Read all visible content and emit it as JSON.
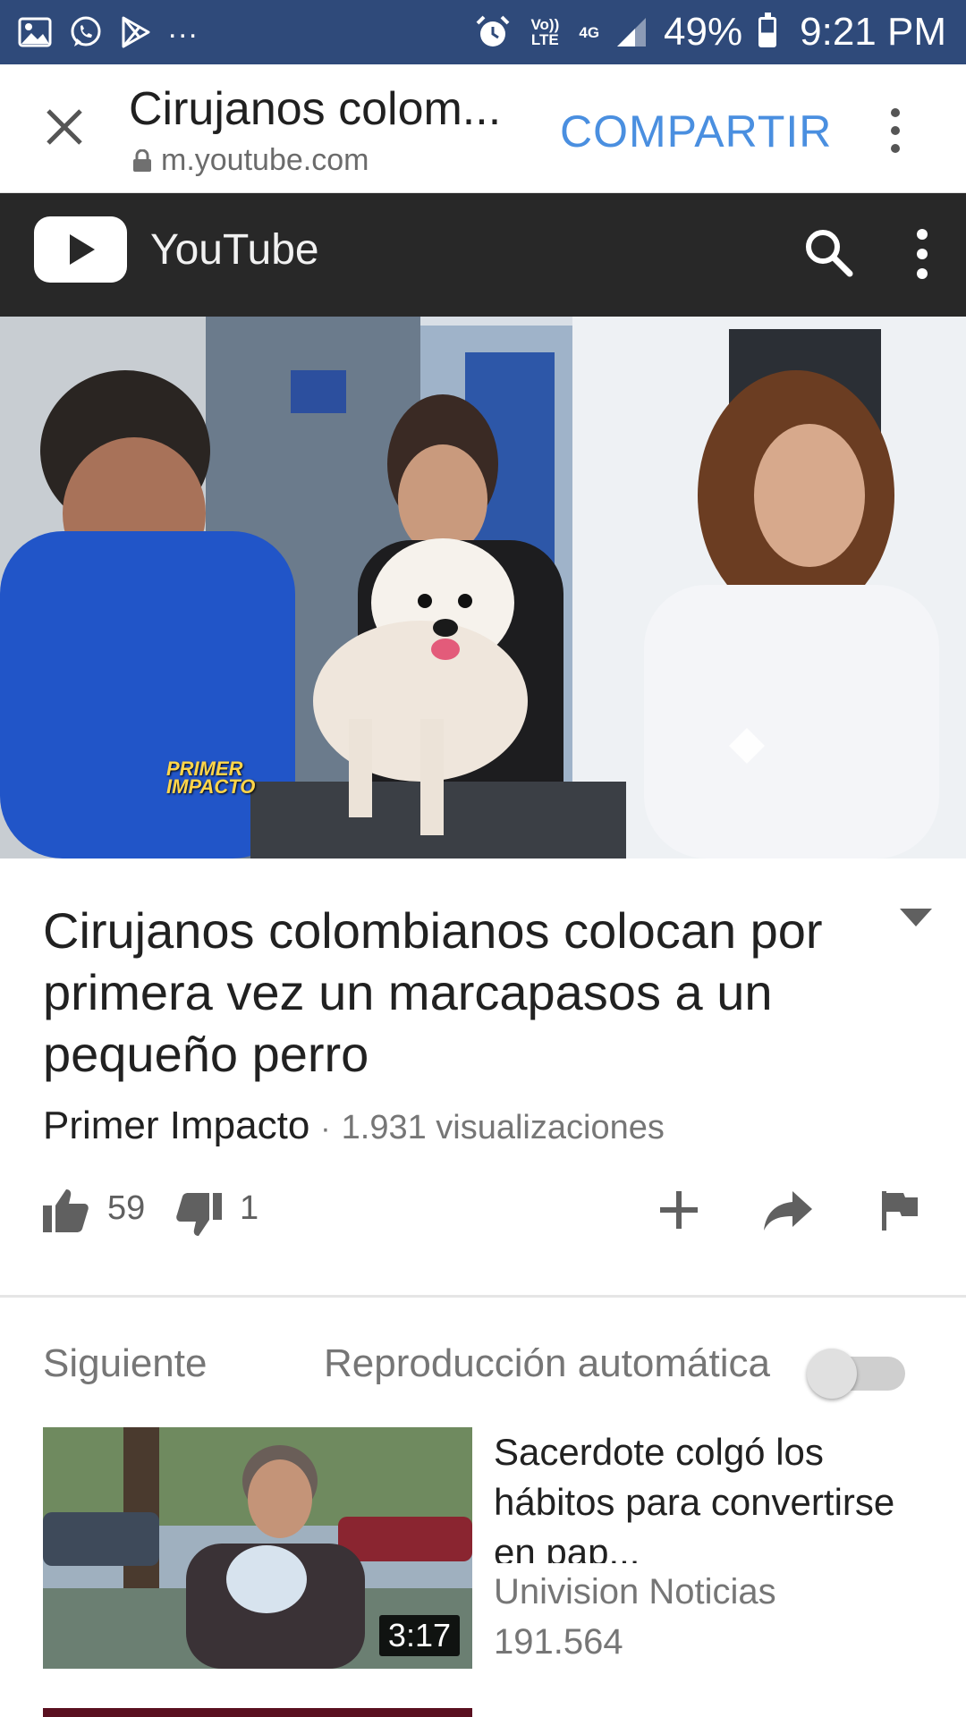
{
  "status_bar": {
    "overflow": "...",
    "volte": "Vo)) LTE",
    "network": "4G",
    "battery": "49%",
    "time": "9:21 PM"
  },
  "tab": {
    "title": "Cirujanos colom...",
    "url": "m.youtube.com",
    "share": "COMPARTIR"
  },
  "youtube": {
    "name": "YouTube"
  },
  "video": {
    "watermark_top": "PRIMER",
    "watermark_bottom": "IMPACTO",
    "title": "Cirujanos colombianos colocan por primera vez un marcapasos a un pequeño perro",
    "channel": "Primer Impacto",
    "separator": "·",
    "views": "1.931 visualizaciones",
    "likes": "59",
    "dislikes": "1"
  },
  "up_next": {
    "label": "Siguiente",
    "autoplay_label": "Reproducción automática",
    "autoplay_on": false,
    "item": {
      "title": "Sacerdote colgó los hábitos para convertirse en pap...",
      "channel": "Univision Noticias",
      "views": "191.564",
      "duration": "3:17"
    }
  },
  "colors": {
    "status_bar": "#2f4a7a",
    "youtube_bar": "#282828",
    "share_accent": "#4a8fe0"
  },
  "icons": [
    "image-icon",
    "whatsapp-icon",
    "play-store-icon",
    "alarm-icon",
    "signal-icon",
    "battery-icon",
    "close-icon",
    "lock-icon",
    "more-vert-icon",
    "youtube-logo-icon",
    "search-icon",
    "thumb-up-icon",
    "thumb-down-icon",
    "add-icon",
    "share-icon",
    "flag-icon",
    "chevron-down-icon"
  ]
}
